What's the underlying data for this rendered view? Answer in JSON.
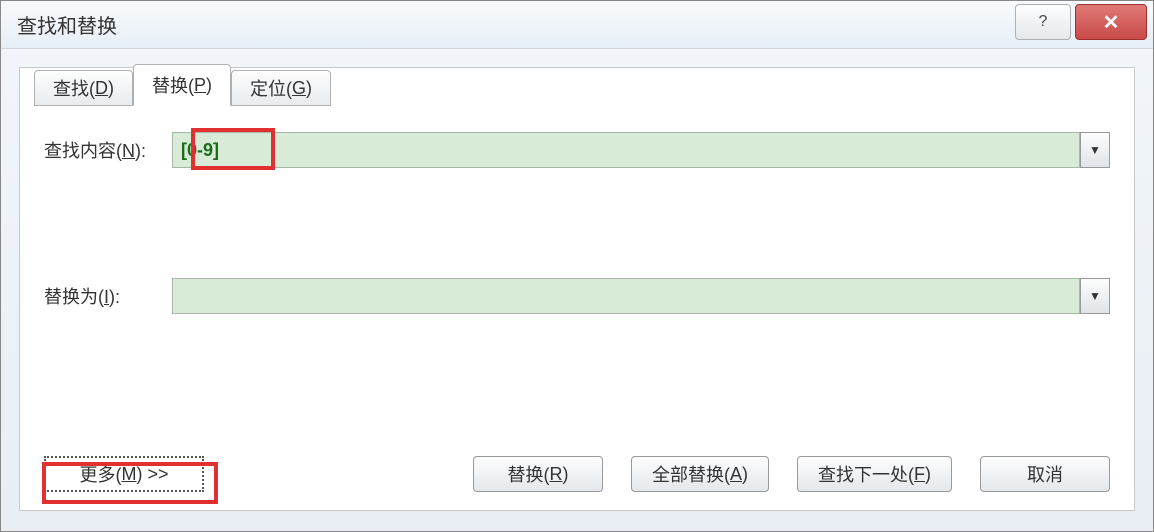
{
  "titlebar": {
    "title": "查找和替换",
    "help": "?",
    "close": "✕"
  },
  "tabs": {
    "find": {
      "label": "查找(",
      "accel": "D",
      "suffix": ")"
    },
    "replace": {
      "label": "替换(",
      "accel": "P",
      "suffix": ")"
    },
    "goto": {
      "label": "定位(",
      "accel": "G",
      "suffix": ")"
    }
  },
  "form": {
    "find_label_prefix": "查找内容(",
    "find_label_accel": "N",
    "find_label_suffix": "):",
    "find_value": "[0-9]",
    "replace_label_prefix": "替换为(",
    "replace_label_accel": "I",
    "replace_label_suffix": "):",
    "replace_value": ""
  },
  "buttons": {
    "more_prefix": "更多(",
    "more_accel": "M",
    "more_suffix": ") >>",
    "replace_prefix": "替换(",
    "replace_accel": "R",
    "replace_suffix": ")",
    "replace_all_prefix": "全部替换(",
    "replace_all_accel": "A",
    "replace_all_suffix": ")",
    "find_next_prefix": "查找下一处(",
    "find_next_accel": "F",
    "find_next_suffix": ")",
    "cancel": "取消"
  },
  "icons": {
    "dropdown": "▼"
  }
}
